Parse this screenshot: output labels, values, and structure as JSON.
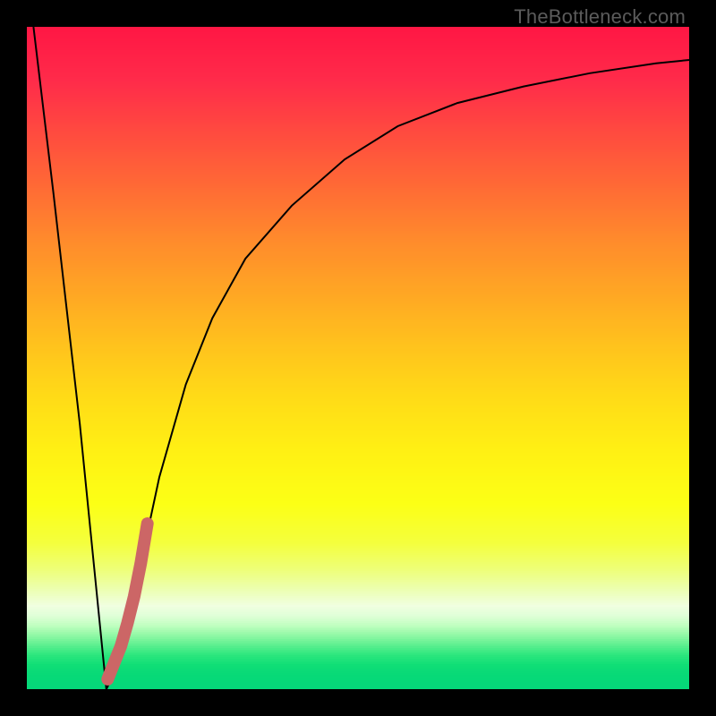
{
  "watermark": "TheBottleneck.com",
  "chart_data": {
    "type": "line",
    "title": "",
    "xlabel": "",
    "ylabel": "",
    "xlim": [
      0,
      100
    ],
    "ylim": [
      0,
      100
    ],
    "grid": false,
    "series": [
      {
        "name": "bottleneck-curve",
        "x": [
          1,
          4,
          8,
          11,
          12,
          13,
          14,
          15,
          17,
          20,
          24,
          28,
          33,
          40,
          48,
          56,
          65,
          75,
          85,
          95,
          100
        ],
        "y": [
          100,
          75,
          40,
          10,
          0,
          2,
          4,
          7,
          18,
          32,
          46,
          56,
          65,
          73,
          80,
          85,
          88.5,
          91,
          93,
          94.5,
          95
        ],
        "color": "#000000",
        "linewidth": 2
      },
      {
        "name": "highlight-segment",
        "x": [
          12.2,
          13.2,
          14.2,
          15.2,
          16.2,
          17.2,
          18.2
        ],
        "y": [
          1.5,
          4,
          6.5,
          10,
          14,
          19,
          25
        ],
        "color": "#cc6666",
        "linewidth": 14
      }
    ],
    "background_gradient": {
      "stops": [
        {
          "pos": 0.0,
          "color": "#ff1744"
        },
        {
          "pos": 0.08,
          "color": "#ff2b4a"
        },
        {
          "pos": 0.16,
          "color": "#ff4b3f"
        },
        {
          "pos": 0.24,
          "color": "#ff6a35"
        },
        {
          "pos": 0.32,
          "color": "#ff8a2c"
        },
        {
          "pos": 0.4,
          "color": "#ffa624"
        },
        {
          "pos": 0.48,
          "color": "#ffc21d"
        },
        {
          "pos": 0.56,
          "color": "#ffdb17"
        },
        {
          "pos": 0.64,
          "color": "#fff014"
        },
        {
          "pos": 0.72,
          "color": "#fcff15"
        },
        {
          "pos": 0.78,
          "color": "#f4ff3d"
        },
        {
          "pos": 0.82,
          "color": "#eeff78"
        },
        {
          "pos": 0.85,
          "color": "#ecffb0"
        },
        {
          "pos": 0.875,
          "color": "#f0ffe0"
        },
        {
          "pos": 0.89,
          "color": "#e0ffd8"
        },
        {
          "pos": 0.905,
          "color": "#c0ffc0"
        },
        {
          "pos": 0.92,
          "color": "#90f8a5"
        },
        {
          "pos": 0.935,
          "color": "#5cef8f"
        },
        {
          "pos": 0.95,
          "color": "#2be67d"
        },
        {
          "pos": 0.965,
          "color": "#10de76"
        },
        {
          "pos": 0.98,
          "color": "#07d977"
        },
        {
          "pos": 1.0,
          "color": "#05d87a"
        }
      ]
    }
  }
}
